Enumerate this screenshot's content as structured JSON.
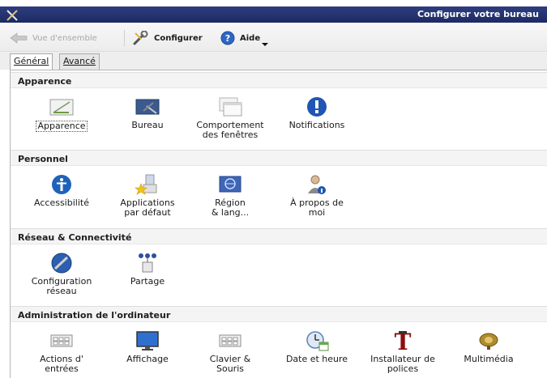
{
  "window": {
    "title": "Configurer votre bureau",
    "accent": "#25336f"
  },
  "toolbar": {
    "overview_label": "Vue d'ensemble",
    "configure_label": "Configurer",
    "help_label": "Aide"
  },
  "tabs": [
    {
      "label": "Général",
      "active": true
    },
    {
      "label": "Avancé",
      "active": false
    }
  ],
  "sections": [
    {
      "title": "Apparence",
      "items": [
        {
          "label": "Apparence",
          "icon": "appearance-icon"
        },
        {
          "label": "Bureau",
          "icon": "desktop-icon"
        },
        {
          "label": "Comportement\ndes fenêtres",
          "icon": "windows-icon"
        },
        {
          "label": "Notifications",
          "icon": "notifications-icon"
        }
      ]
    },
    {
      "title": "Personnel",
      "items": [
        {
          "label": "Accessibilité",
          "icon": "accessibility-icon"
        },
        {
          "label": "Applications\npar défaut",
          "icon": "default-applications-icon"
        },
        {
          "label": "Région\n& lang...",
          "icon": "region-language-icon"
        },
        {
          "label": "À propos de\nmoi",
          "icon": "about-me-icon"
        }
      ]
    },
    {
      "title": "Réseau & Connectivité",
      "items": [
        {
          "label": "Configuration\nréseau",
          "icon": "network-settings-icon"
        },
        {
          "label": "Partage",
          "icon": "sharing-icon"
        }
      ]
    },
    {
      "title": "Administration de l'ordinateur",
      "items": [
        {
          "label": "Actions d'\nentrées",
          "icon": "input-actions-icon"
        },
        {
          "label": "Affichage",
          "icon": "display-icon"
        },
        {
          "label": "Clavier &\nSouris",
          "icon": "keyboard-mouse-icon"
        },
        {
          "label": "Date et heure",
          "icon": "date-time-icon"
        },
        {
          "label": "Installateur de\npolices",
          "icon": "font-installer-icon"
        },
        {
          "label": "Multimédia",
          "icon": "multimedia-icon"
        }
      ]
    }
  ]
}
